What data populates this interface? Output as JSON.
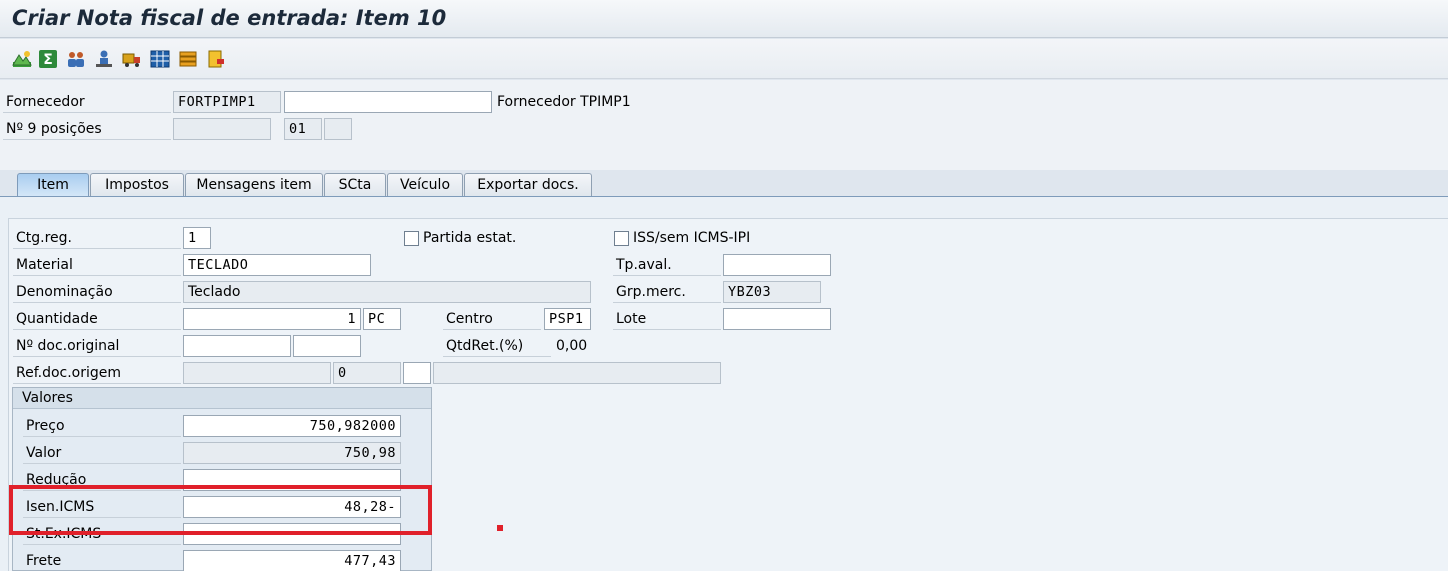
{
  "title": "Criar Nota fiscal de entrada: Item 10",
  "toolbar": {
    "icons": [
      "mountain-chart-icon",
      "sigma-icon",
      "partners-icon",
      "user-stamp-icon",
      "truck-icon",
      "grid-table-icon",
      "stack-icon",
      "document-flag-icon"
    ]
  },
  "header": {
    "fornecedor_label": "Fornecedor",
    "fornecedor_value": "FORTPIMP1",
    "fornecedor_extra": "",
    "fornecedor_desc": "Fornecedor TPIMP1",
    "posicoes_label": "Nº 9 posições",
    "posicoes_value": "",
    "posicoes_code": "01",
    "posicoes_extra": ""
  },
  "tabs": [
    {
      "label": "Item",
      "active": true
    },
    {
      "label": "Impostos",
      "active": false
    },
    {
      "label": "Mensagens item",
      "active": false
    },
    {
      "label": "SCta",
      "active": false
    },
    {
      "label": "Veículo",
      "active": false
    },
    {
      "label": "Exportar docs.",
      "active": false
    }
  ],
  "item": {
    "ctg_reg_label": "Ctg.reg.",
    "ctg_reg_value": "1",
    "partida_label": "Partida estat.",
    "iss_label": "ISS/sem ICMS-IPI",
    "material_label": "Material",
    "material_value": "TECLADO",
    "tp_aval_label": "Tp.aval.",
    "tp_aval_value": "",
    "denominacao_label": "Denominação",
    "denominacao_value": "Teclado",
    "grp_merc_label": "Grp.merc.",
    "grp_merc_value": "YBZ03",
    "quantidade_label": "Quantidade",
    "quantidade_value": "1",
    "quantidade_unit": "PC",
    "centro_label": "Centro",
    "centro_value": "PSP1",
    "lote_label": "Lote",
    "lote_value": "",
    "doc_original_label": "Nº doc.original",
    "doc_original_value": "",
    "doc_original_value2": "",
    "qtdret_label": "QtdRet.(%)",
    "qtdret_value": "0,00",
    "ref_doc_label": "Ref.doc.origem",
    "ref_doc_value": "",
    "ref_doc_num": "0",
    "ref_doc_extra": "",
    "ref_doc_desc": ""
  },
  "valores": {
    "title": "Valores",
    "preco_label": "Preço",
    "preco_value": "750,982000",
    "valor_label": "Valor",
    "valor_value": "750,98",
    "reducao_label": "Redução",
    "reducao_value": "",
    "isen_icms_label": "Isen.ICMS",
    "isen_icms_value": "48,28-",
    "st_ex_icms_label": "St.Ex.ICMS",
    "st_ex_icms_value": "",
    "frete_label": "Frete",
    "frete_value": "477,43"
  },
  "colors": {
    "highlight": "#e0202a",
    "active_tab": "#bcdaf5"
  }
}
